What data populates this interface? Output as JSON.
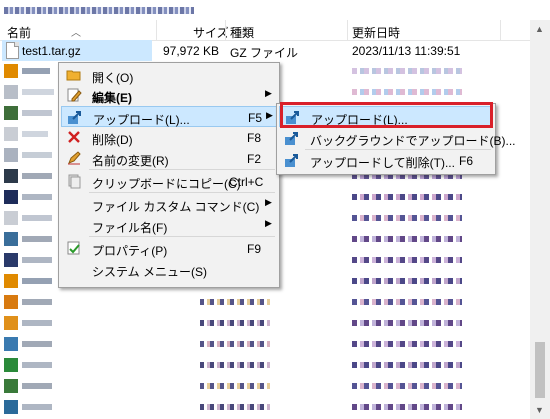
{
  "window": {
    "title": ""
  },
  "columns": {
    "name": "名前",
    "size": "サイズ",
    "type": "種類",
    "modified": "更新日時"
  },
  "file": {
    "name": "test1.tar.gz",
    "size": "97,972 KB",
    "type": "GZ ファイル",
    "modified": "2023/11/13 11:39:51"
  },
  "context_menu": {
    "open": "開く(O)",
    "edit": "編集(E)",
    "upload": "アップロード(L)...",
    "upload_shortcut": "F5",
    "delete": "削除(D)",
    "delete_shortcut": "F8",
    "rename": "名前の変更(R)",
    "rename_shortcut": "F2",
    "copy_clipboard": "クリップボードにコピー(C)",
    "copy_shortcut": "Ctrl+C",
    "custom_command": "ファイル カスタム コマンド(C)",
    "filename": "ファイル名(F)",
    "properties": "プロパティ(P)",
    "properties_shortcut": "F9",
    "system_menu": "システム メニュー(S)"
  },
  "submenu": {
    "upload": "アップロード(L)...",
    "background_upload": "バックグラウンドでアップロード(B)...",
    "upload_delete": "アップロードして削除(T)...",
    "upload_delete_shortcut": "F6"
  },
  "colors": {
    "selection": "#cce8ff",
    "menu_bg": "#f2f2f2",
    "highlight_border": "#d9202a"
  }
}
